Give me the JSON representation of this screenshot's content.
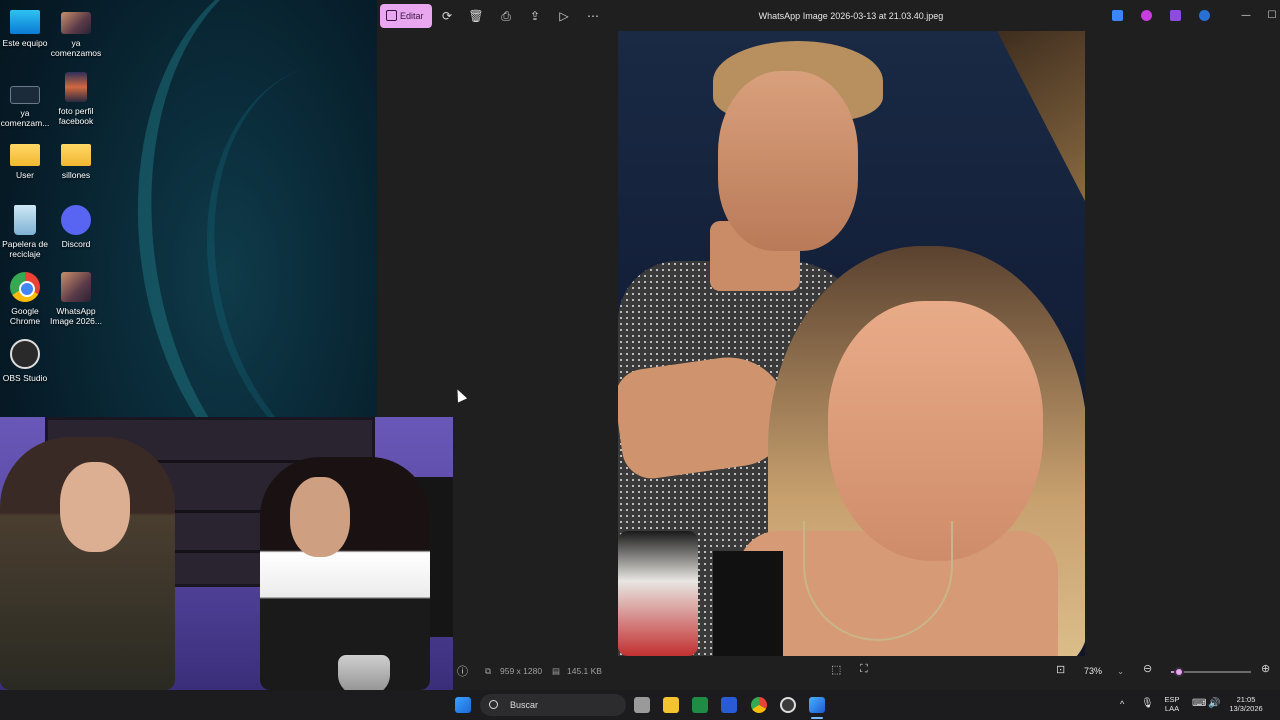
{
  "desktop": {
    "icons": [
      {
        "label": "Este equipo"
      },
      {
        "label": "ya comenzamos"
      },
      {
        "label": "ya comenzam..."
      },
      {
        "label": "foto perfil facebook"
      },
      {
        "label": "User"
      },
      {
        "label": "sillones"
      },
      {
        "label": "Papelera de reciclaje"
      },
      {
        "label": "Discord"
      },
      {
        "label": "Google Chrome"
      },
      {
        "label": "WhatsApp Image 2026..."
      },
      {
        "label": "OBS Studio"
      }
    ]
  },
  "viewer": {
    "edit_label": "Editar",
    "title": "WhatsApp Image 2026-03-13 at 21.03.40.jpeg",
    "toolbar_icons": [
      "rotate-icon",
      "delete-icon",
      "print-icon",
      "share-icon",
      "slideshow-icon",
      "more-icon"
    ],
    "status": {
      "dimensions": "959 x 1280",
      "file_size": "145.1 KB",
      "zoom": "73%",
      "zoom_level": 0.1
    }
  },
  "taskbar": {
    "search_placeholder": "Buscar",
    "lang_top": "ESP",
    "lang_bottom": "LAA",
    "time": "21:05",
    "date": "13/3/2026"
  },
  "colors": {
    "accent": "#e8a7ee",
    "viewer_bg": "#1f1f1f",
    "taskbar_bg": "#1c1c1e"
  }
}
